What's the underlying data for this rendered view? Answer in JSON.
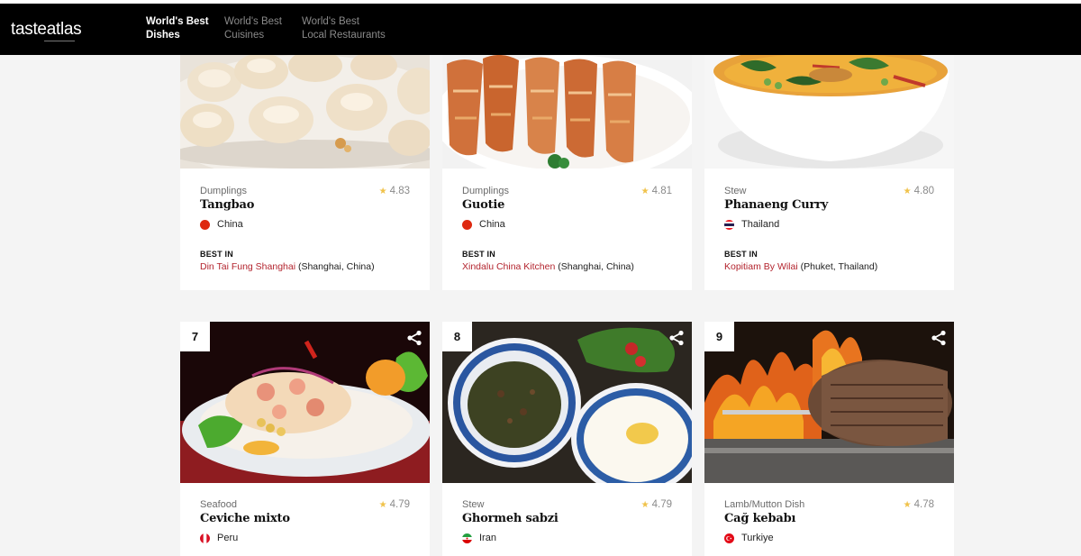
{
  "brand": {
    "logo_left": "taste",
    "logo_right": "atlas"
  },
  "nav": [
    {
      "line1": "World's Best",
      "line2": "Dishes",
      "active": true
    },
    {
      "line1": "World's Best",
      "line2": "Cuisines",
      "active": false
    },
    {
      "line1": "World's Best",
      "line2": "Local Restaurants",
      "active": false
    }
  ],
  "best_in_label": "BEST IN",
  "dishes_top": [
    {
      "category": "Dumplings",
      "rating": "4.83",
      "name": "Tangbao",
      "country": "China",
      "restaurant": "Din Tai Fung Shanghai",
      "location": "(Shanghai, China)"
    },
    {
      "category": "Dumplings",
      "rating": "4.81",
      "name": "Guotie",
      "country": "China",
      "restaurant": "Xindalu China Kitchen",
      "location": "(Shanghai, China)"
    },
    {
      "category": "Stew",
      "rating": "4.80",
      "name": "Phanaeng Curry",
      "country": "Thailand",
      "restaurant": "Kopitiam By Wilai",
      "location": "(Phuket, Thailand)"
    }
  ],
  "dishes_bottom": [
    {
      "rank": "7",
      "category": "Seafood",
      "rating": "4.79",
      "name": "Ceviche mixto",
      "country": "Peru"
    },
    {
      "rank": "8",
      "category": "Stew",
      "rating": "4.79",
      "name": "Ghormeh sabzi",
      "country": "Iran"
    },
    {
      "rank": "9",
      "category": "Lamb/Mutton Dish",
      "rating": "4.78",
      "name": "Cağ kebabı",
      "country": "Turkiye"
    }
  ],
  "colors": {
    "header_bg": "#000000",
    "restaurant_link": "#b3242e",
    "star": "#f0c24a"
  }
}
